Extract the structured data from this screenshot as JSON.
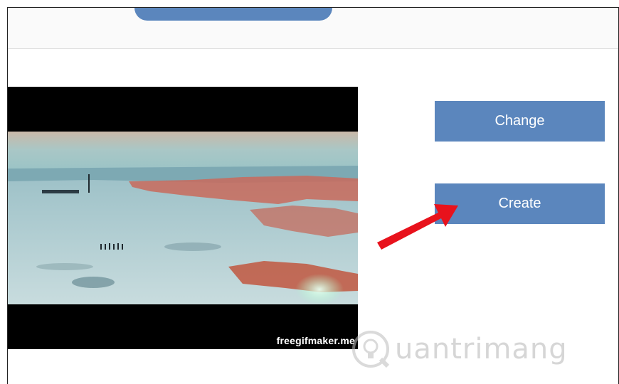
{
  "buttons": {
    "change_label": "Change",
    "create_label": "Create"
  },
  "preview": {
    "watermark": "freegifmaker.me"
  },
  "logo": {
    "text": "uantrimang"
  },
  "colors": {
    "accent": "#5b86bd",
    "arrow": "#e8121c"
  }
}
